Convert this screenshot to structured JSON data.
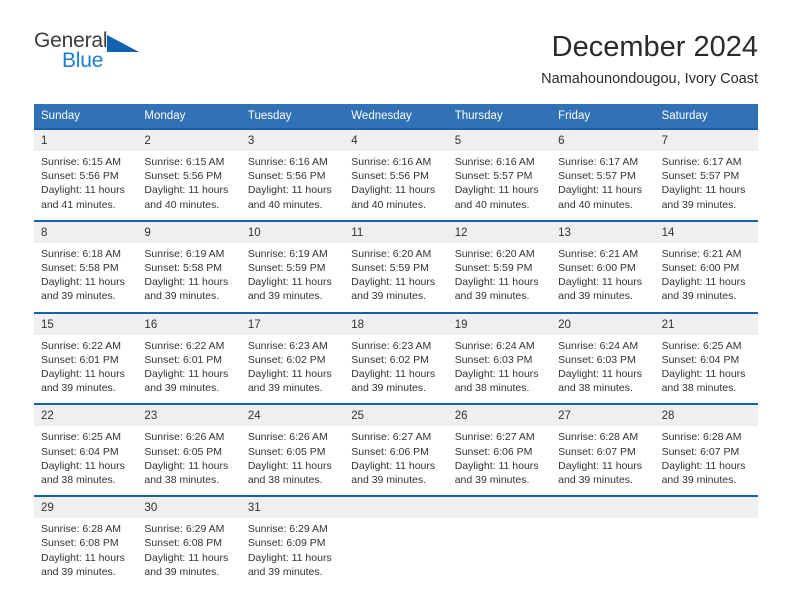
{
  "brand": {
    "name_top": "General",
    "name_bottom": "Blue",
    "triangle_color": "#1263af",
    "blue_text_color": "#1a7fd4"
  },
  "header": {
    "title": "December 2024",
    "subtitle": "Namahounondougou, Ivory Coast"
  },
  "theme": {
    "header_blue": "#3072b5",
    "separator_blue": "#1263af",
    "daynum_gray": "#efefef"
  },
  "weekday_headers": [
    "Sunday",
    "Monday",
    "Tuesday",
    "Wednesday",
    "Thursday",
    "Friday",
    "Saturday"
  ],
  "weeks": [
    {
      "days": [
        {
          "num": "1",
          "sunrise": "Sunrise: 6:15 AM",
          "sunset": "Sunset: 5:56 PM",
          "daylight1": "Daylight: 11 hours",
          "daylight2": "and 41 minutes."
        },
        {
          "num": "2",
          "sunrise": "Sunrise: 6:15 AM",
          "sunset": "Sunset: 5:56 PM",
          "daylight1": "Daylight: 11 hours",
          "daylight2": "and 40 minutes."
        },
        {
          "num": "3",
          "sunrise": "Sunrise: 6:16 AM",
          "sunset": "Sunset: 5:56 PM",
          "daylight1": "Daylight: 11 hours",
          "daylight2": "and 40 minutes."
        },
        {
          "num": "4",
          "sunrise": "Sunrise: 6:16 AM",
          "sunset": "Sunset: 5:56 PM",
          "daylight1": "Daylight: 11 hours",
          "daylight2": "and 40 minutes."
        },
        {
          "num": "5",
          "sunrise": "Sunrise: 6:16 AM",
          "sunset": "Sunset: 5:57 PM",
          "daylight1": "Daylight: 11 hours",
          "daylight2": "and 40 minutes."
        },
        {
          "num": "6",
          "sunrise": "Sunrise: 6:17 AM",
          "sunset": "Sunset: 5:57 PM",
          "daylight1": "Daylight: 11 hours",
          "daylight2": "and 40 minutes."
        },
        {
          "num": "7",
          "sunrise": "Sunrise: 6:17 AM",
          "sunset": "Sunset: 5:57 PM",
          "daylight1": "Daylight: 11 hours",
          "daylight2": "and 39 minutes."
        }
      ]
    },
    {
      "days": [
        {
          "num": "8",
          "sunrise": "Sunrise: 6:18 AM",
          "sunset": "Sunset: 5:58 PM",
          "daylight1": "Daylight: 11 hours",
          "daylight2": "and 39 minutes."
        },
        {
          "num": "9",
          "sunrise": "Sunrise: 6:19 AM",
          "sunset": "Sunset: 5:58 PM",
          "daylight1": "Daylight: 11 hours",
          "daylight2": "and 39 minutes."
        },
        {
          "num": "10",
          "sunrise": "Sunrise: 6:19 AM",
          "sunset": "Sunset: 5:59 PM",
          "daylight1": "Daylight: 11 hours",
          "daylight2": "and 39 minutes."
        },
        {
          "num": "11",
          "sunrise": "Sunrise: 6:20 AM",
          "sunset": "Sunset: 5:59 PM",
          "daylight1": "Daylight: 11 hours",
          "daylight2": "and 39 minutes."
        },
        {
          "num": "12",
          "sunrise": "Sunrise: 6:20 AM",
          "sunset": "Sunset: 5:59 PM",
          "daylight1": "Daylight: 11 hours",
          "daylight2": "and 39 minutes."
        },
        {
          "num": "13",
          "sunrise": "Sunrise: 6:21 AM",
          "sunset": "Sunset: 6:00 PM",
          "daylight1": "Daylight: 11 hours",
          "daylight2": "and 39 minutes."
        },
        {
          "num": "14",
          "sunrise": "Sunrise: 6:21 AM",
          "sunset": "Sunset: 6:00 PM",
          "daylight1": "Daylight: 11 hours",
          "daylight2": "and 39 minutes."
        }
      ]
    },
    {
      "days": [
        {
          "num": "15",
          "sunrise": "Sunrise: 6:22 AM",
          "sunset": "Sunset: 6:01 PM",
          "daylight1": "Daylight: 11 hours",
          "daylight2": "and 39 minutes."
        },
        {
          "num": "16",
          "sunrise": "Sunrise: 6:22 AM",
          "sunset": "Sunset: 6:01 PM",
          "daylight1": "Daylight: 11 hours",
          "daylight2": "and 39 minutes."
        },
        {
          "num": "17",
          "sunrise": "Sunrise: 6:23 AM",
          "sunset": "Sunset: 6:02 PM",
          "daylight1": "Daylight: 11 hours",
          "daylight2": "and 39 minutes."
        },
        {
          "num": "18",
          "sunrise": "Sunrise: 6:23 AM",
          "sunset": "Sunset: 6:02 PM",
          "daylight1": "Daylight: 11 hours",
          "daylight2": "and 39 minutes."
        },
        {
          "num": "19",
          "sunrise": "Sunrise: 6:24 AM",
          "sunset": "Sunset: 6:03 PM",
          "daylight1": "Daylight: 11 hours",
          "daylight2": "and 38 minutes."
        },
        {
          "num": "20",
          "sunrise": "Sunrise: 6:24 AM",
          "sunset": "Sunset: 6:03 PM",
          "daylight1": "Daylight: 11 hours",
          "daylight2": "and 38 minutes."
        },
        {
          "num": "21",
          "sunrise": "Sunrise: 6:25 AM",
          "sunset": "Sunset: 6:04 PM",
          "daylight1": "Daylight: 11 hours",
          "daylight2": "and 38 minutes."
        }
      ]
    },
    {
      "days": [
        {
          "num": "22",
          "sunrise": "Sunrise: 6:25 AM",
          "sunset": "Sunset: 6:04 PM",
          "daylight1": "Daylight: 11 hours",
          "daylight2": "and 38 minutes."
        },
        {
          "num": "23",
          "sunrise": "Sunrise: 6:26 AM",
          "sunset": "Sunset: 6:05 PM",
          "daylight1": "Daylight: 11 hours",
          "daylight2": "and 38 minutes."
        },
        {
          "num": "24",
          "sunrise": "Sunrise: 6:26 AM",
          "sunset": "Sunset: 6:05 PM",
          "daylight1": "Daylight: 11 hours",
          "daylight2": "and 38 minutes."
        },
        {
          "num": "25",
          "sunrise": "Sunrise: 6:27 AM",
          "sunset": "Sunset: 6:06 PM",
          "daylight1": "Daylight: 11 hours",
          "daylight2": "and 39 minutes."
        },
        {
          "num": "26",
          "sunrise": "Sunrise: 6:27 AM",
          "sunset": "Sunset: 6:06 PM",
          "daylight1": "Daylight: 11 hours",
          "daylight2": "and 39 minutes."
        },
        {
          "num": "27",
          "sunrise": "Sunrise: 6:28 AM",
          "sunset": "Sunset: 6:07 PM",
          "daylight1": "Daylight: 11 hours",
          "daylight2": "and 39 minutes."
        },
        {
          "num": "28",
          "sunrise": "Sunrise: 6:28 AM",
          "sunset": "Sunset: 6:07 PM",
          "daylight1": "Daylight: 11 hours",
          "daylight2": "and 39 minutes."
        }
      ]
    },
    {
      "days": [
        {
          "num": "29",
          "sunrise": "Sunrise: 6:28 AM",
          "sunset": "Sunset: 6:08 PM",
          "daylight1": "Daylight: 11 hours",
          "daylight2": "and 39 minutes."
        },
        {
          "num": "30",
          "sunrise": "Sunrise: 6:29 AM",
          "sunset": "Sunset: 6:08 PM",
          "daylight1": "Daylight: 11 hours",
          "daylight2": "and 39 minutes."
        },
        {
          "num": "31",
          "sunrise": "Sunrise: 6:29 AM",
          "sunset": "Sunset: 6:09 PM",
          "daylight1": "Daylight: 11 hours",
          "daylight2": "and 39 minutes."
        },
        {
          "num": "",
          "sunrise": "",
          "sunset": "",
          "daylight1": "",
          "daylight2": ""
        },
        {
          "num": "",
          "sunrise": "",
          "sunset": "",
          "daylight1": "",
          "daylight2": ""
        },
        {
          "num": "",
          "sunrise": "",
          "sunset": "",
          "daylight1": "",
          "daylight2": ""
        },
        {
          "num": "",
          "sunrise": "",
          "sunset": "",
          "daylight1": "",
          "daylight2": ""
        }
      ]
    }
  ]
}
